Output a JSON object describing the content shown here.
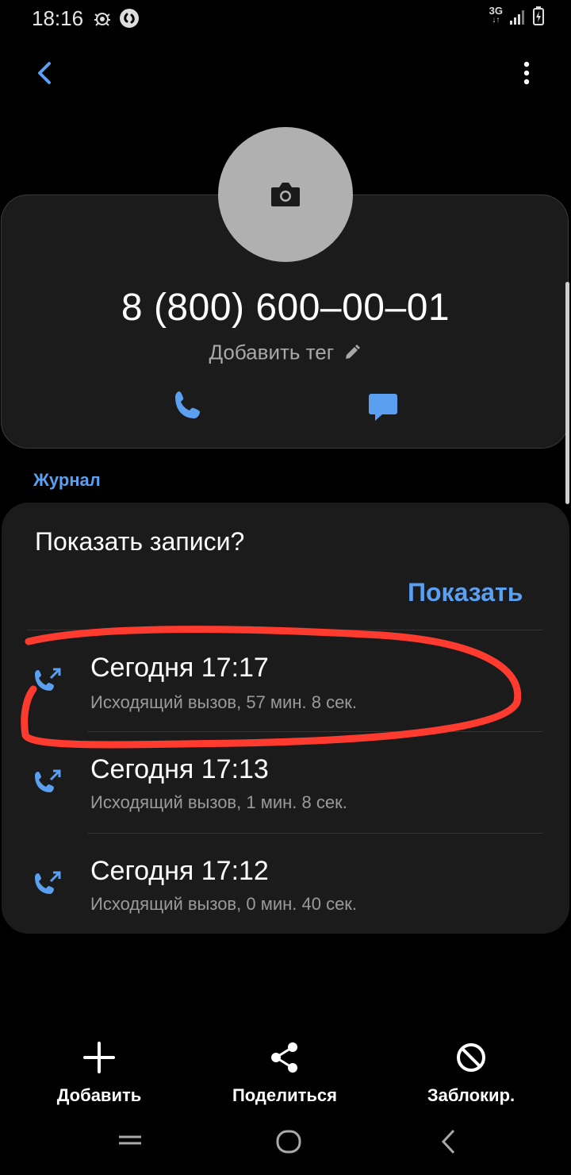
{
  "status_bar": {
    "time": "18:16",
    "network": "3G"
  },
  "contact": {
    "phone_number": "8 (800) 600–00–01",
    "add_tag_label": "Добавить тег"
  },
  "log": {
    "section_label": "Журнал",
    "prompt_title": "Показать записи?",
    "show_button": "Показать",
    "entries": [
      {
        "title": "Сегодня 17:17",
        "detail": "Исходящий вызов, 57 мин. 8 сек."
      },
      {
        "title": "Сегодня 17:13",
        "detail": "Исходящий вызов, 1 мин. 8 сек."
      },
      {
        "title": "Сегодня 17:12",
        "detail": "Исходящий вызов, 0 мин. 40 сек."
      }
    ]
  },
  "actions": {
    "add_label": "Добавить",
    "share_label": "Поделиться",
    "block_label": "Заблокир."
  },
  "colors": {
    "accent": "#5a9ff0",
    "card_bg": "#1b1b1b",
    "highlight_annotation": "#ff3b30"
  },
  "icons": {
    "back": "chevron-left-icon",
    "more": "more-vertical-icon",
    "camera": "camera-icon",
    "call": "phone-icon",
    "message": "message-icon",
    "outgoing_call": "outgoing-call-icon",
    "add": "plus-icon",
    "share": "share-icon",
    "block": "block-icon"
  }
}
